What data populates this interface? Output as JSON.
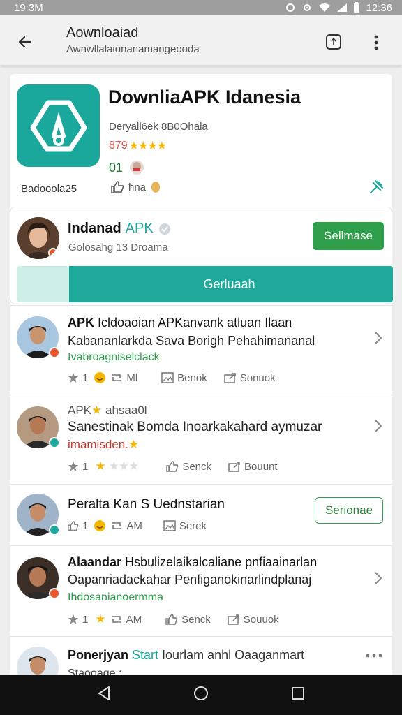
{
  "status": {
    "time": "19:3M",
    "right_time": "12:36"
  },
  "appbar": {
    "title": "Aownloaiad",
    "subtitle": "Awnwllalaionanamangeooda"
  },
  "app": {
    "name": "DownliaAPK Idanesia",
    "developer": "Deryall6ek 8B0Ohala",
    "rating_num": "879",
    "rating_stars": "★★★★",
    "extra": "01",
    "downloads": "Badooola25",
    "likes": "ħna",
    "colors": {
      "brand": "#1aa79c",
      "accent": "#2e9e4a"
    }
  },
  "author": {
    "name": "Indanad",
    "name_accent": "APK",
    "subtitle": "Golosahg 13 Droama",
    "follow_label": "Sellmase",
    "download_label": "Gerluaah",
    "download_progress": 0.86
  },
  "reviews": [
    {
      "title_bold": "APK",
      "title_rest": " Icldoaoian APKanvank atluan Ilaan",
      "line2": "Kabananlarkda Sava Borigh Pehahimananal",
      "tag": "Ivabroagniselclack",
      "tag_color": "green",
      "stat1": "1",
      "stat2": "Ml",
      "action1": "Benok",
      "action2": "Sonuok"
    },
    {
      "title_bold": "APK",
      "title_rest": " ahsaa0l",
      "line2": "Sanestinak Bomda Inoarkakahard aymuzar",
      "tag": "imamisden.",
      "tag_color": "orange",
      "stat1": "1",
      "stat2": "",
      "action1": "Senck",
      "action2": "Bouunt"
    },
    {
      "title_bold": "",
      "title_rest": "Peralta Kan S Uednstarian",
      "line2": "",
      "tag": "",
      "tag_color": "green",
      "stat1": "1",
      "stat2": "AM",
      "action1": "Serek",
      "action2": "",
      "button": "Serionae"
    },
    {
      "title_bold": "Alaandar",
      "title_rest": " Hsbulizelaikalcaliane pnfiaainarlan",
      "line2": "Oapanriadackahar Penfiganokinarlindplanaj",
      "tag": "Ihdosanianoermma",
      "tag_color": "green",
      "stat1": "1",
      "stat2": "AM",
      "action1": "Senck",
      "action2": "Souuok"
    },
    {
      "title_bold": "Ponerjyan",
      "title_accent": " Start",
      "title_rest": " Iourlam anhl Oaaganmart",
      "line2": "Staooage :",
      "tag": "",
      "tag_color": "green"
    }
  ]
}
